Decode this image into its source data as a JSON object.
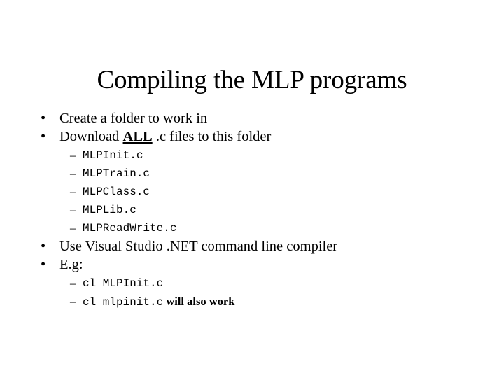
{
  "slide": {
    "title": "Compiling the MLP programs",
    "background_color": "#ffffff",
    "text_color": "#000000",
    "bullet_glyph": "•",
    "dash_glyph": "–",
    "content": [
      {
        "level": 1,
        "text": "Create a folder to work in"
      },
      {
        "level": 1,
        "prefix": "Download ",
        "emphasis": "ALL",
        "suffix": " .c files to this folder"
      },
      {
        "level": 2,
        "text": "MLPInit.c"
      },
      {
        "level": 2,
        "text": "MLPTrain.c"
      },
      {
        "level": 2,
        "text": "MLPClass.c"
      },
      {
        "level": 2,
        "text": "MLPLib.c"
      },
      {
        "level": 2,
        "text": "MLPReadWrite.c"
      },
      {
        "level": 1,
        "text": "Use Visual Studio .NET command line compiler"
      },
      {
        "level": 1,
        "text": "E.g:"
      },
      {
        "level": 2,
        "text": "cl MLPInit.c"
      },
      {
        "level": 2,
        "mono_text": "cl mlpinit.c",
        "trailing_text": " will also work"
      }
    ]
  }
}
